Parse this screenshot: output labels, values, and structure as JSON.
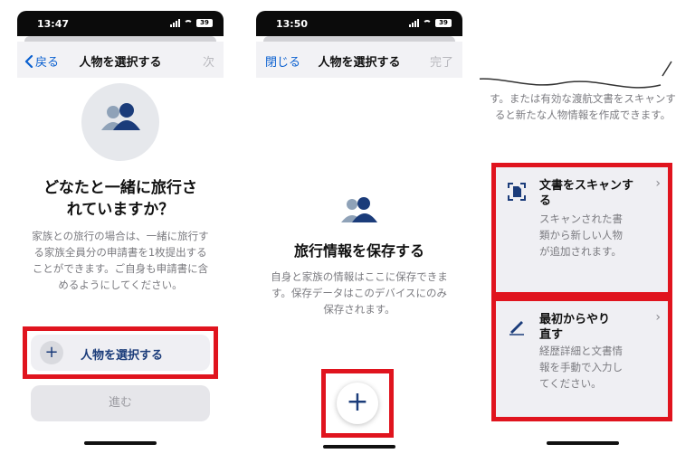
{
  "screen1": {
    "time": "13:47",
    "battery": "39",
    "back_label": "戻る",
    "nav_title": "人物を選択する",
    "nav_right": "次",
    "heading": "どなたと一緒に旅行されていますか？",
    "body": "家族との旅行の場合は、一緒に旅行する家族全員分の申請書を1枚提出することができます。ご自身も申請書に含めるようにしてください。",
    "select_button": "人物を選択する",
    "next_button": "進む"
  },
  "screen2": {
    "time": "13:50",
    "battery": "39",
    "close_label": "閉じる",
    "nav_title": "人物を選択する",
    "nav_right": "完了",
    "heading": "旅行情報を保存する",
    "body": "自身と家族の情報はここに保存できます。保存データはこのデバイスにのみ保存されます。",
    "fab_label": "+"
  },
  "screen3": {
    "top_text": "す。または有効な渡航文書をスキャンすると新たな人物情報を作成できます。",
    "cards": [
      {
        "icon": "document-scan-icon",
        "title": "文書をスキャンする",
        "desc": "スキャンされた書類から新しい人物が追加されます。"
      },
      {
        "icon": "pencil-icon",
        "title": "最初からやり直す",
        "desc": "経歴詳細と文書情報を手動で入力してください。"
      }
    ]
  },
  "colors": {
    "accent": "#0a60d0",
    "navy": "#1b3c7a",
    "highlight": "#e0141e"
  }
}
